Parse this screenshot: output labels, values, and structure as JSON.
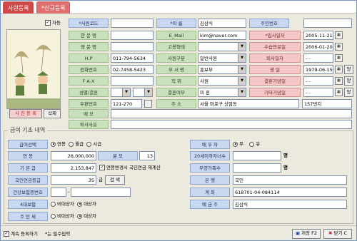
{
  "tabs": {
    "tab1": "사원등록",
    "tab2": "*신규등록"
  },
  "top": {
    "check_label": "자동",
    "empcode_label": "*사원코드",
    "empcode_value": "",
    "name_label": "*이 름",
    "name_value": "김삼식",
    "rrn_label": "주민번호",
    "rrn_value": ""
  },
  "left": {
    "hanmun_label": "한 문 명",
    "hanmun_value": "",
    "english_label": "영 문 명",
    "english_value": "",
    "hp_label": "H.P",
    "hp_value": "011-794-5634",
    "tel_label": "전화번호",
    "tel_value": "02-7458-5423",
    "fax_label": "F A X",
    "fax_value": "",
    "gender_label": "성별/결혼",
    "zip_label": "우편번호",
    "zip_value": "121-270",
    "memo_label": "메 모",
    "memo_value": "",
    "retire_reason_label": "퇴사사유",
    "retire_reason_value": ""
  },
  "mid": {
    "email_label": "E_Mail",
    "email_value": "kim@naver.com",
    "employ_type_label": "고용형태",
    "employ_type_value": "",
    "emp_class_label": "사원구분",
    "emp_class_value": "일반사원",
    "dept_label": "부 서 명",
    "dept_value": "홍보부",
    "position_label": "직 위",
    "position_value": "사원",
    "married_label": "결혼여부",
    "married_value": "미 혼",
    "address_label": "주 소",
    "address_value": "서울 마포구 상암동",
    "address_detail": "157번지"
  },
  "right": {
    "hire_label": "*입사일자",
    "hire_value": "2005-11-21",
    "probation_label": "수습만료일",
    "probation_value": "2006-01-20",
    "retire_label": "퇴사일자",
    "retire_value": "  -  -  ",
    "birth_label": "생 일",
    "birth_value": "1979-06-15",
    "birth_type": "양",
    "anniversary_label": "결혼기념일",
    "anniversary_value": "  -  -  ",
    "anniversary_type": "양",
    "other_label": "기타기념일",
    "other_value": "  -  -  ",
    "other_type": "양"
  },
  "photo": {
    "register_btn": "사 진 등 록",
    "delete_btn": "삭제"
  },
  "salary": {
    "title": "급여 기초 내역",
    "pay_sel_label": "급여선택",
    "pay_opt1": "연봉",
    "pay_opt2": "월급",
    "pay_opt3": "시급",
    "annual_label": "연 봉",
    "annual_value": "28,000,000",
    "div_label": "분 모",
    "div_value": "13",
    "base_label": "기 본 급",
    "base_value": "2,153,847",
    "pension_chk": "연봉변경시 국민연금 재계산",
    "pension_label": "국민연금등급",
    "pension_value": "35",
    "pension_unit": "급",
    "search_btn": "검 색",
    "health_label": "건강보험증번호",
    "health_value": "",
    "ins_label": "4대보험",
    "ins_opt1": "비대상자",
    "ins_opt2": "대상자",
    "resident_tax_label": "주 민 세",
    "res_opt1": "비대상자",
    "res_opt2": "대상자",
    "spouse_label": "배 우 자",
    "spouse_opt1": "무",
    "spouse_opt2": "유",
    "under20_label": "20세이하자녀수",
    "under20_value": "",
    "under20_unit": "명",
    "dependents_label": "부양가족수",
    "dependents_value": "",
    "dependents_unit": "명",
    "bank_label": "은 행",
    "bank_value": "국민",
    "account_label": "계 좌",
    "account_value": "618701-04-084114",
    "holder_label": "예 금 주",
    "holder_value": "김삼식"
  },
  "footer": {
    "continue_label": "계속 등록하기",
    "required_note": "*는 필수입력",
    "save_btn": "저장 F2",
    "close_btn": "닫기 C"
  }
}
